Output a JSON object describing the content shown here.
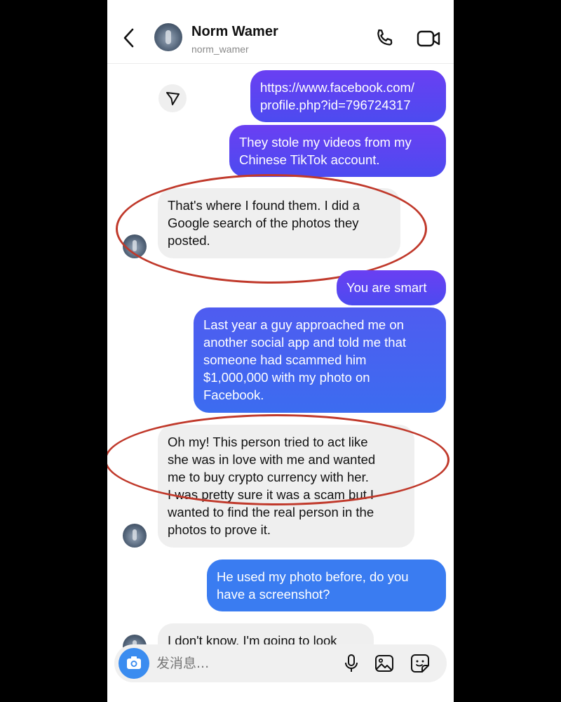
{
  "header": {
    "contact_name": "Norm Wamer",
    "contact_handle": "norm_wamer",
    "icons": [
      "back-arrow-icon",
      "phone-icon",
      "video-camera-icon"
    ]
  },
  "messages": [
    {
      "direction": "outgoing",
      "text": "https://www.facebook.com/\nprofile.php?id=796724317"
    },
    {
      "direction": "outgoing",
      "text": "They stole my videos from my\nChinese TikTok account."
    },
    {
      "direction": "incoming",
      "text": "That's where I found them. I did a\nGoogle search of the  photos they\nposted.",
      "highlighted": true
    },
    {
      "direction": "outgoing",
      "text": "You are smart"
    },
    {
      "direction": "outgoing",
      "text": "Last year a guy approached me on\nanother social app and told me that\nsomeone had scammed him\n$1,000,000 with my photo on\nFacebook."
    },
    {
      "direction": "incoming",
      "text": "Oh my!  This person tried to act like\nshe was in love with me and wanted\nme to buy crypto currency with her.\nI was pretty sure it was a scam but I\nwanted to find the real person in the\nphotos to prove it.",
      "highlighted": true
    },
    {
      "direction": "outgoing",
      "text": "He used my photo before, do you\nhave a screenshot?"
    },
    {
      "direction": "incoming",
      "text": "I don't know. I'm going to look"
    }
  ],
  "composer": {
    "placeholder": "发消息...",
    "icons": [
      "camera-icon",
      "microphone-icon",
      "gallery-icon",
      "sticker-icon"
    ]
  },
  "colors": {
    "outgoing_top": "#6a3ff2",
    "outgoing_bottom": "#3a7cf1",
    "incoming": "#efefef",
    "highlight_circle": "#c0392b",
    "camera_button": "#3a8cf0"
  }
}
